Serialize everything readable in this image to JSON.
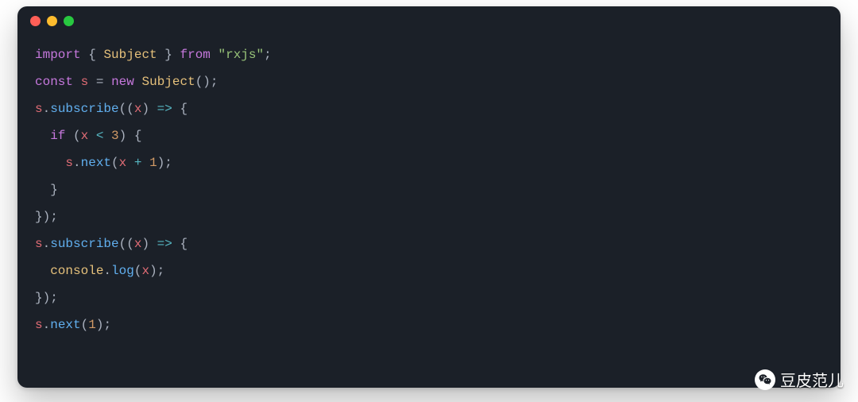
{
  "window": {
    "traffic_lights": [
      "red",
      "yellow",
      "green"
    ]
  },
  "code": {
    "lines": [
      [
        {
          "t": "import",
          "c": "tok-kw"
        },
        {
          "t": " ",
          "c": "tok-punc"
        },
        {
          "t": "{",
          "c": "tok-punc"
        },
        {
          "t": " ",
          "c": "tok-punc"
        },
        {
          "t": "Subject",
          "c": "tok-type"
        },
        {
          "t": " ",
          "c": "tok-punc"
        },
        {
          "t": "}",
          "c": "tok-punc"
        },
        {
          "t": " ",
          "c": "tok-punc"
        },
        {
          "t": "from",
          "c": "tok-kw"
        },
        {
          "t": " ",
          "c": "tok-punc"
        },
        {
          "t": "\"rxjs\"",
          "c": "tok-str"
        },
        {
          "t": ";",
          "c": "tok-punc"
        }
      ],
      [
        {
          "t": "const",
          "c": "tok-kw"
        },
        {
          "t": " ",
          "c": "tok-punc"
        },
        {
          "t": "s",
          "c": "tok-var"
        },
        {
          "t": " ",
          "c": "tok-punc"
        },
        {
          "t": "=",
          "c": "tok-punc"
        },
        {
          "t": " ",
          "c": "tok-punc"
        },
        {
          "t": "new",
          "c": "tok-kw"
        },
        {
          "t": " ",
          "c": "tok-punc"
        },
        {
          "t": "Subject",
          "c": "tok-type"
        },
        {
          "t": "()",
          "c": "tok-punc"
        },
        {
          "t": ";",
          "c": "tok-punc"
        }
      ],
      [
        {
          "t": "s",
          "c": "tok-var"
        },
        {
          "t": ".",
          "c": "tok-punc"
        },
        {
          "t": "subscribe",
          "c": "tok-fn"
        },
        {
          "t": "((",
          "c": "tok-punc"
        },
        {
          "t": "x",
          "c": "tok-var"
        },
        {
          "t": ")",
          "c": "tok-punc"
        },
        {
          "t": " ",
          "c": "tok-punc"
        },
        {
          "t": "=>",
          "c": "tok-op"
        },
        {
          "t": " ",
          "c": "tok-punc"
        },
        {
          "t": "{",
          "c": "tok-punc"
        }
      ],
      [
        {
          "t": "  ",
          "c": "tok-punc"
        },
        {
          "t": "if",
          "c": "tok-kw"
        },
        {
          "t": " (",
          "c": "tok-punc"
        },
        {
          "t": "x",
          "c": "tok-var"
        },
        {
          "t": " ",
          "c": "tok-punc"
        },
        {
          "t": "<",
          "c": "tok-op"
        },
        {
          "t": " ",
          "c": "tok-punc"
        },
        {
          "t": "3",
          "c": "tok-num"
        },
        {
          "t": ")",
          "c": "tok-punc"
        },
        {
          "t": " ",
          "c": "tok-punc"
        },
        {
          "t": "{",
          "c": "tok-punc"
        }
      ],
      [
        {
          "t": "    ",
          "c": "tok-punc"
        },
        {
          "t": "s",
          "c": "tok-var"
        },
        {
          "t": ".",
          "c": "tok-punc"
        },
        {
          "t": "next",
          "c": "tok-fn"
        },
        {
          "t": "(",
          "c": "tok-punc"
        },
        {
          "t": "x",
          "c": "tok-var"
        },
        {
          "t": " ",
          "c": "tok-punc"
        },
        {
          "t": "+",
          "c": "tok-op"
        },
        {
          "t": " ",
          "c": "tok-punc"
        },
        {
          "t": "1",
          "c": "tok-num"
        },
        {
          "t": ")",
          "c": "tok-punc"
        },
        {
          "t": ";",
          "c": "tok-punc"
        }
      ],
      [
        {
          "t": "  ",
          "c": "tok-punc"
        },
        {
          "t": "}",
          "c": "tok-punc"
        }
      ],
      [
        {
          "t": "})",
          "c": "tok-punc"
        },
        {
          "t": ";",
          "c": "tok-punc"
        }
      ],
      [
        {
          "t": "s",
          "c": "tok-var"
        },
        {
          "t": ".",
          "c": "tok-punc"
        },
        {
          "t": "subscribe",
          "c": "tok-fn"
        },
        {
          "t": "((",
          "c": "tok-punc"
        },
        {
          "t": "x",
          "c": "tok-var"
        },
        {
          "t": ")",
          "c": "tok-punc"
        },
        {
          "t": " ",
          "c": "tok-punc"
        },
        {
          "t": "=>",
          "c": "tok-op"
        },
        {
          "t": " ",
          "c": "tok-punc"
        },
        {
          "t": "{",
          "c": "tok-punc"
        }
      ],
      [
        {
          "t": "  ",
          "c": "tok-punc"
        },
        {
          "t": "console",
          "c": "tok-obj"
        },
        {
          "t": ".",
          "c": "tok-punc"
        },
        {
          "t": "log",
          "c": "tok-fn"
        },
        {
          "t": "(",
          "c": "tok-punc"
        },
        {
          "t": "x",
          "c": "tok-var"
        },
        {
          "t": ")",
          "c": "tok-punc"
        },
        {
          "t": ";",
          "c": "tok-punc"
        }
      ],
      [
        {
          "t": "})",
          "c": "tok-punc"
        },
        {
          "t": ";",
          "c": "tok-punc"
        }
      ],
      [
        {
          "t": "s",
          "c": "tok-var"
        },
        {
          "t": ".",
          "c": "tok-punc"
        },
        {
          "t": "next",
          "c": "tok-fn"
        },
        {
          "t": "(",
          "c": "tok-punc"
        },
        {
          "t": "1",
          "c": "tok-num"
        },
        {
          "t": ")",
          "c": "tok-punc"
        },
        {
          "t": ";",
          "c": "tok-punc"
        }
      ]
    ]
  },
  "watermark": {
    "icon_name": "wechat-icon",
    "text": "豆皮范儿"
  }
}
